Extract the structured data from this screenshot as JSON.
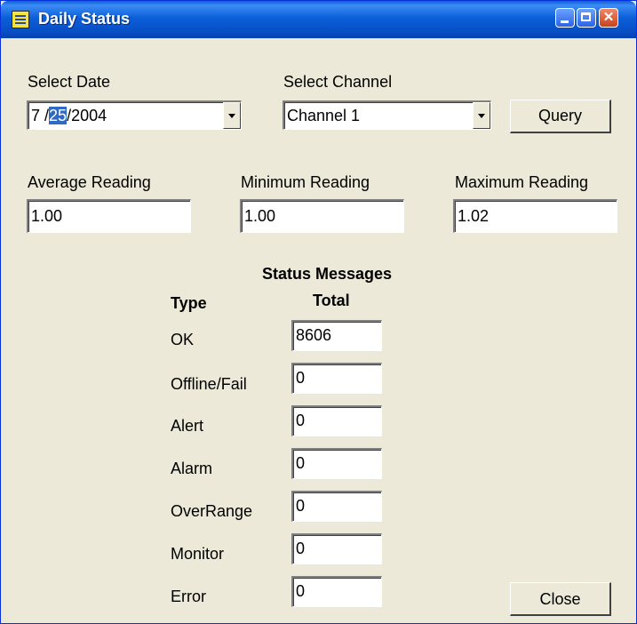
{
  "window": {
    "title": "Daily Status"
  },
  "date": {
    "label": "Select Date",
    "month": "7",
    "separator1": " /",
    "day": "25",
    "rest": "/2004"
  },
  "channel": {
    "label": "Select Channel",
    "value": "Channel 1"
  },
  "query_label": "Query",
  "readings": {
    "average_label": "Average Reading",
    "average_value": "1.00",
    "minimum_label": "Minimum Reading",
    "minimum_value": "1.00",
    "maximum_label": "Maximum Reading",
    "maximum_value": "1.02"
  },
  "status": {
    "heading": "Status Messages",
    "type_header": "Type",
    "total_header": "Total",
    "rows": [
      {
        "type": "OK",
        "total": "8606"
      },
      {
        "type": "Offline/Fail",
        "total": "0"
      },
      {
        "type": "Alert",
        "total": "0"
      },
      {
        "type": "Alarm",
        "total": "0"
      },
      {
        "type": "OverRange",
        "total": "0"
      },
      {
        "type": "Monitor",
        "total": "0"
      },
      {
        "type": "Error",
        "total": "0"
      }
    ]
  },
  "close_label": "Close"
}
